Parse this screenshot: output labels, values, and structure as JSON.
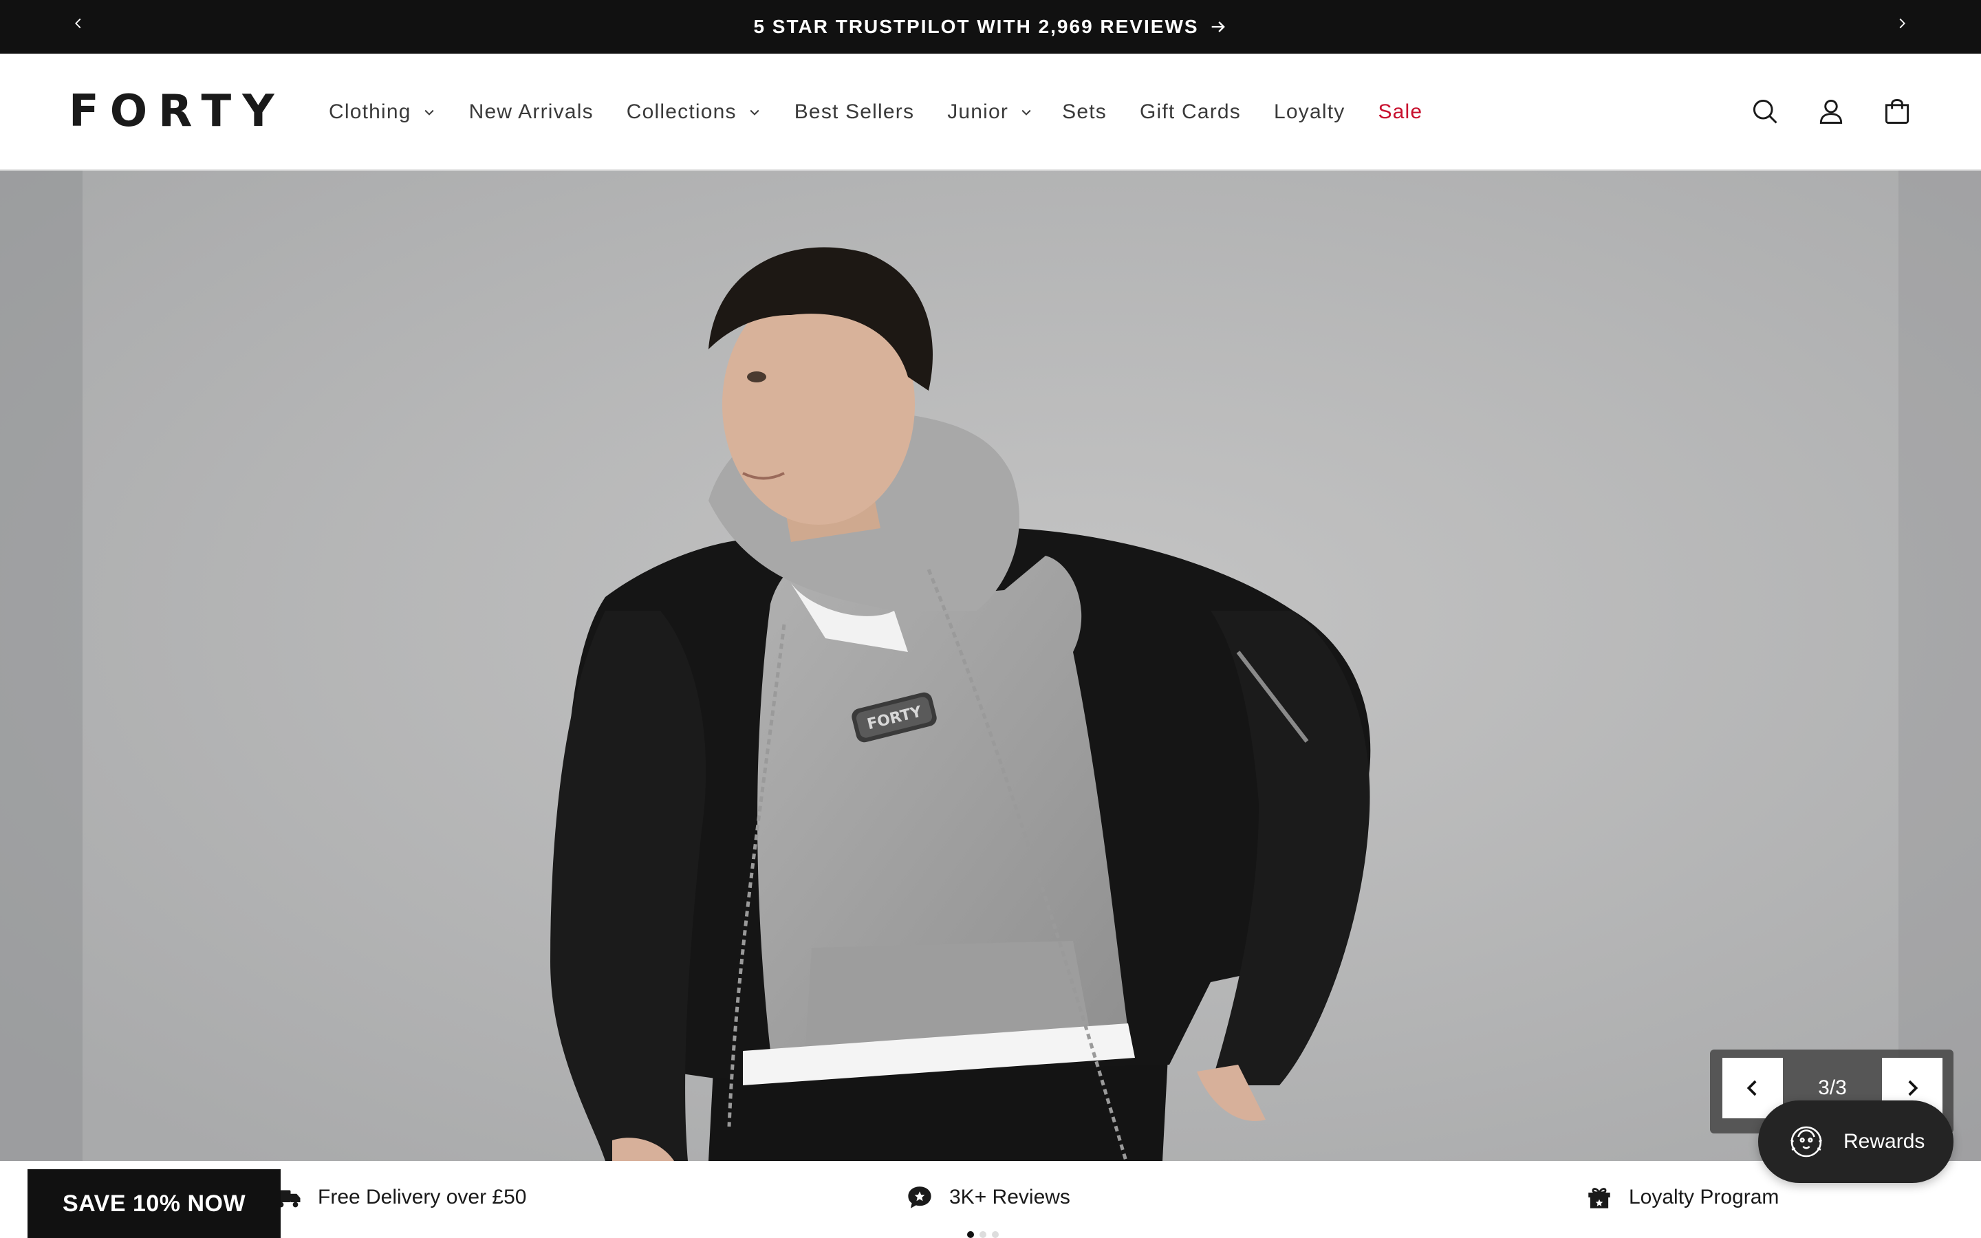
{
  "announcement": {
    "text": "5 STAR TRUSTPILOT WITH 2,969 REVIEWS",
    "arrow_icon": "arrow-right-icon"
  },
  "header": {
    "logo": "FORTY",
    "nav": [
      {
        "label": "Clothing",
        "dropdown": true
      },
      {
        "label": "New Arrivals",
        "dropdown": false
      },
      {
        "label": "Collections",
        "dropdown": true
      },
      {
        "label": "Best Sellers",
        "dropdown": false
      },
      {
        "label": "Junior",
        "dropdown": true
      },
      {
        "label": "Sets",
        "dropdown": false
      },
      {
        "label": "Gift Cards",
        "dropdown": false
      },
      {
        "label": "Loyalty",
        "dropdown": false
      },
      {
        "label": "Sale",
        "dropdown": false,
        "color": "#c8102e"
      }
    ],
    "icons": [
      "search-icon",
      "account-icon",
      "cart-icon"
    ]
  },
  "hero": {
    "slide_counter": "3/3",
    "logo_badge": "FORTY"
  },
  "usp": [
    {
      "icon": "delivery-icon",
      "label": "Free Delivery over £50"
    },
    {
      "icon": "chat-star-icon",
      "label": "3K+ Reviews"
    },
    {
      "icon": "gift-icon",
      "label": "Loyalty Program"
    }
  ],
  "promo": {
    "save_label": "SAVE 10% NOW"
  },
  "rewards": {
    "label": "Rewards"
  },
  "colors": {
    "announcement_bg": "#111111",
    "sale": "#c8102e",
    "rewards_bg": "#242424"
  }
}
